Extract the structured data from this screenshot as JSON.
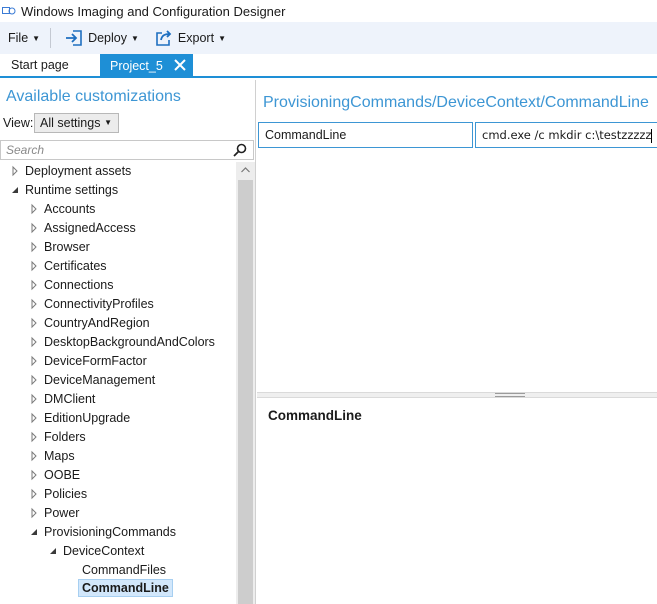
{
  "window": {
    "title": "Windows Imaging and Configuration Designer"
  },
  "menubar": {
    "file_label": "File",
    "deploy_label": "Deploy",
    "export_label": "Export"
  },
  "tabs": {
    "start_label": "Start page",
    "project_label": "Project_5"
  },
  "left": {
    "heading": "Available customizations",
    "view_label": "View:",
    "view_value": "All settings",
    "search_placeholder": "Search",
    "tree": [
      {
        "label": "Deployment assets",
        "expanded": false
      },
      {
        "label": "Runtime settings",
        "expanded": true
      },
      {
        "label": "Accounts",
        "expanded": false
      },
      {
        "label": "AssignedAccess",
        "expanded": false
      },
      {
        "label": "Browser",
        "expanded": false
      },
      {
        "label": "Certificates",
        "expanded": false
      },
      {
        "label": "Connections",
        "expanded": false
      },
      {
        "label": "ConnectivityProfiles",
        "expanded": false
      },
      {
        "label": "CountryAndRegion",
        "expanded": false
      },
      {
        "label": "DesktopBackgroundAndColors",
        "expanded": false
      },
      {
        "label": "DeviceFormFactor",
        "expanded": false
      },
      {
        "label": "DeviceManagement",
        "expanded": false
      },
      {
        "label": "DMClient",
        "expanded": false
      },
      {
        "label": "EditionUpgrade",
        "expanded": false
      },
      {
        "label": "Folders",
        "expanded": false
      },
      {
        "label": "Maps",
        "expanded": false
      },
      {
        "label": "OOBE",
        "expanded": false
      },
      {
        "label": "Policies",
        "expanded": false
      },
      {
        "label": "Power",
        "expanded": false
      },
      {
        "label": "ProvisioningCommands",
        "expanded": true
      },
      {
        "label": "DeviceContext",
        "expanded": true
      },
      {
        "label": "CommandFiles",
        "expanded": null
      },
      {
        "label": "CommandLine",
        "expanded": null,
        "selected": true
      }
    ]
  },
  "right": {
    "path_title": "ProvisioningCommands/DeviceContext/CommandLine",
    "setting_name": "CommandLine",
    "setting_value": "cmd.exe /c mkdir c:\\testzzzzz",
    "detail_title": "CommandLine"
  },
  "colors": {
    "accent": "#1e8fd6",
    "heading_blue": "#3d96d4",
    "menubar_bg": "#eef3fb",
    "selection_bg": "#d2e7fb"
  }
}
